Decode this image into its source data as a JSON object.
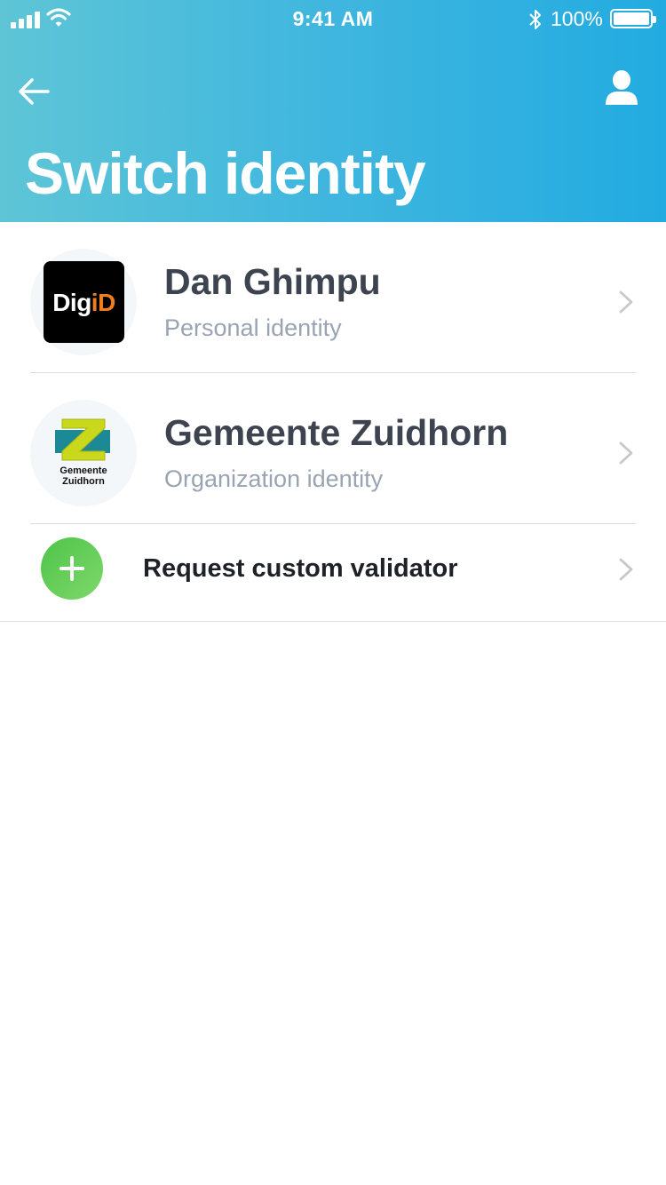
{
  "status_bar": {
    "time": "9:41 AM",
    "battery_percent": "100%",
    "battery_level": 1.0,
    "icons": [
      "cellular-signal-icon",
      "wifi-icon",
      "bluetooth-icon",
      "battery-icon"
    ]
  },
  "header": {
    "title": "Switch identity",
    "back_icon": "arrow-left-icon",
    "profile_icon": "user-icon",
    "gradient": [
      "#5ec5d6",
      "#22abe0"
    ]
  },
  "identities": [
    {
      "name": "Dan Ghimpu",
      "type": "Personal identity",
      "logo": {
        "prefix": "Dig",
        "accent": "iD",
        "accent_color": "#f07e1b",
        "background": "#000000"
      }
    },
    {
      "name": "Gemeente Zuidhorn",
      "type": "Organization identity",
      "logo": {
        "line1": "Gemeente",
        "line2": "Zuidhorn",
        "colors": [
          "#1b8a96",
          "#c9d81a"
        ]
      }
    }
  ],
  "request": {
    "label": "Request custom validator",
    "icon": "plus-icon",
    "accent": "#4dc44a"
  },
  "colors": {
    "title_text": "#3d4450",
    "subtitle_text": "#9aa3b2",
    "divider": "#dcdde0"
  }
}
